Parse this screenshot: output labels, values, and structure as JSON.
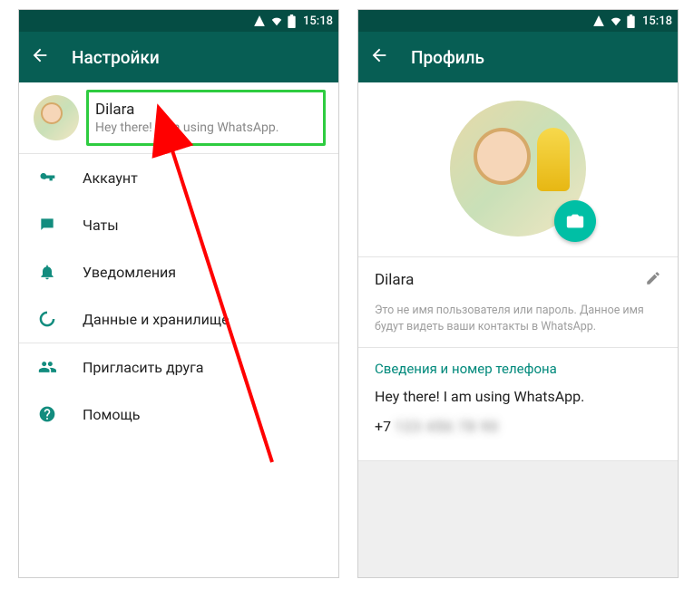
{
  "status": {
    "time": "15:18"
  },
  "settings": {
    "title": "Настройки",
    "profile": {
      "name": "Dilara",
      "status": "Hey there! I am using WhatsApp."
    },
    "items": [
      {
        "icon": "key",
        "label": "Аккаунт"
      },
      {
        "icon": "chat",
        "label": "Чаты"
      },
      {
        "icon": "bell",
        "label": "Уведомления"
      },
      {
        "icon": "data",
        "label": "Данные и хранилище"
      },
      {
        "icon": "invite",
        "label": "Пригласить друга"
      },
      {
        "icon": "help",
        "label": "Помощь"
      }
    ]
  },
  "profile": {
    "title": "Профиль",
    "name": "Dilara",
    "hint": "Это не имя пользователя или пароль. Данное имя будут видеть ваши контакты в WhatsApp.",
    "info_title": "Сведения и номер телефона",
    "status": "Hey there! I am using WhatsApp.",
    "phone_prefix": "+7",
    "phone_hidden": "123 456 78 90"
  }
}
